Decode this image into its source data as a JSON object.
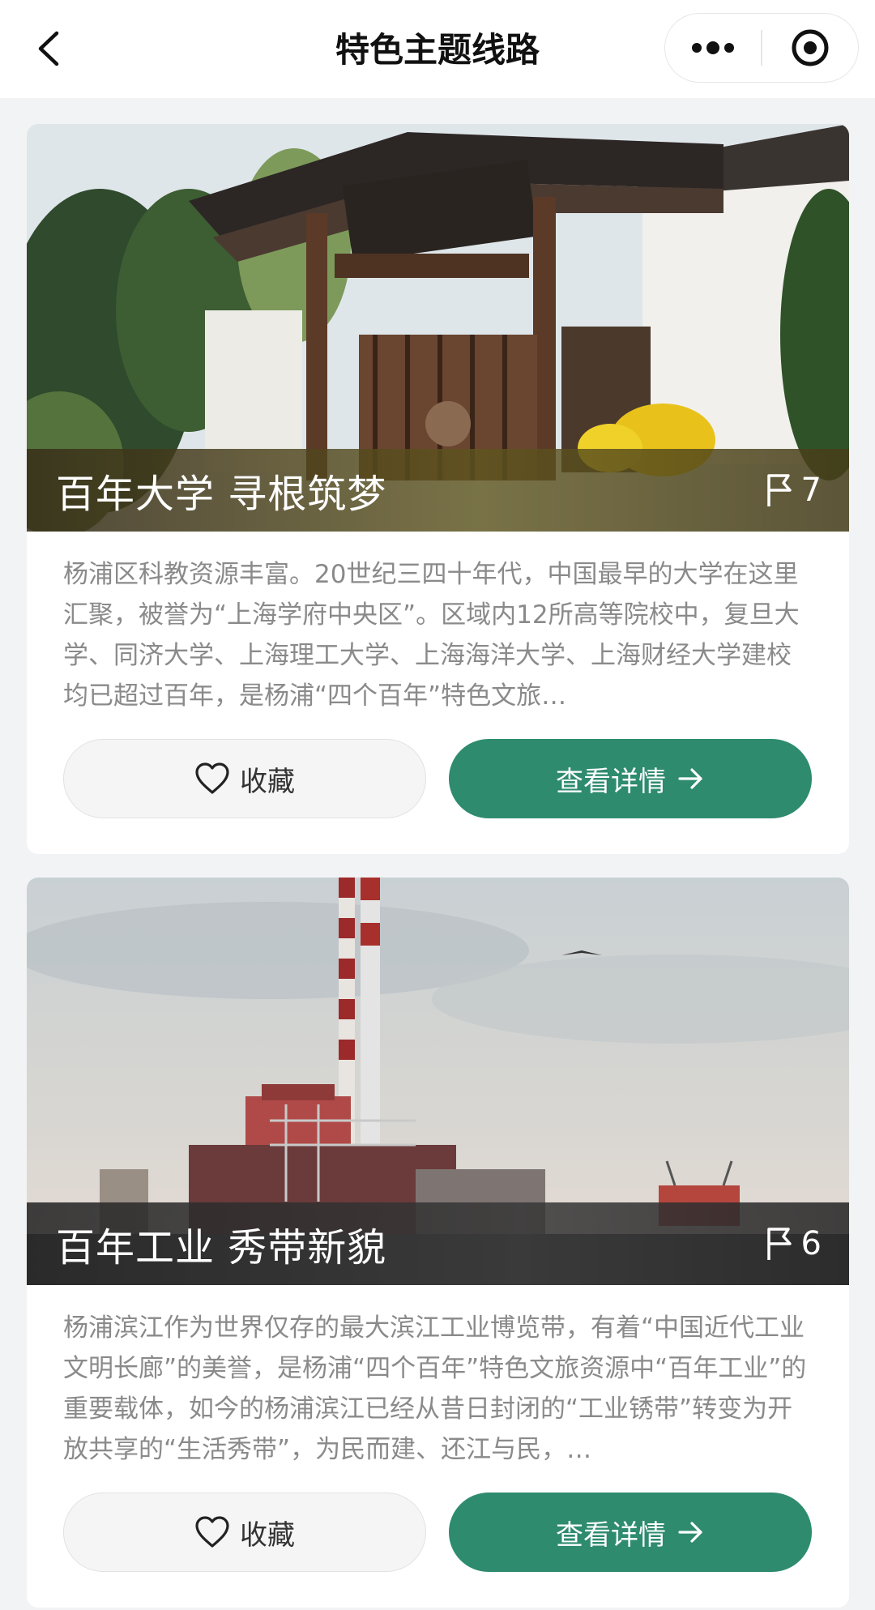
{
  "navbar": {
    "title": "特色主题线路",
    "back_icon": "chevron-left-icon",
    "more_icon": "more-dots-icon",
    "close_icon": "target-circle-icon"
  },
  "theme": {
    "accent": "#2e8b6e",
    "desc_color": "#8a8a8a",
    "page_bg": "#f2f3f5"
  },
  "routes": [
    {
      "title": "百年大学 寻根筑梦",
      "stops": "7",
      "image": "fudan-university-gate-photo",
      "description": "杨浦区科教资源丰富。20世纪三四十年代，中国最早的大学在这里汇聚，被誉为“上海学府中央区”。区域内12所高等院校中，复旦大学、同济大学、上海理工大学、上海海洋大学、上海财经大学建校均已超过百年，是杨浦“四个百年”特色文旅…",
      "favorite_label": "收藏",
      "detail_label": "查看详情"
    },
    {
      "title": "百年工业 秀带新貌",
      "stops": "6",
      "image": "industrial-chimneys-riverside-photo",
      "description": "杨浦滨江作为世界仅存的最大滨江工业博览带，有着“中国近代工业文明长廊”的美誉，是杨浦“四个百年”特色文旅资源中“百年工业”的重要载体，如今的杨浦滨江已经从昔日封闭的“工业锈带”转变为开放共享的“生活秀带”，为民而建、还江与民，…",
      "favorite_label": "收藏",
      "detail_label": "查看详情"
    }
  ]
}
